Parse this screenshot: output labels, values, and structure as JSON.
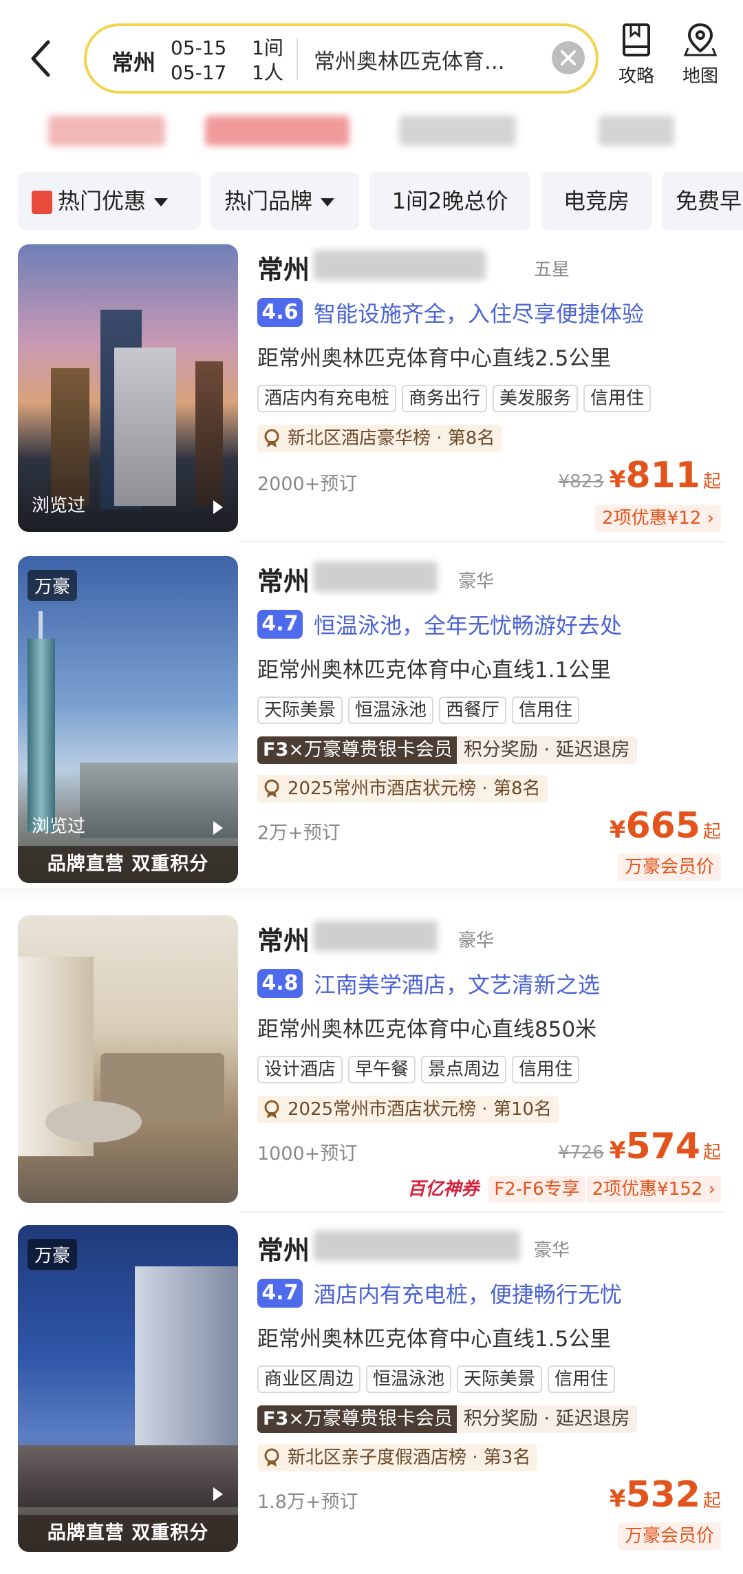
{
  "search": {
    "city": "常州",
    "checkin": "05-15",
    "checkout": "05-17",
    "rooms": "1间",
    "guests": "1人",
    "query": "常州奥林匹克体育..."
  },
  "top_actions": {
    "guide": "攻略",
    "map": "地图"
  },
  "filters": [
    {
      "label": "热门优惠"
    },
    {
      "label": "热门品牌"
    },
    {
      "label": "1间2晚总价"
    },
    {
      "label": "电竞房"
    },
    {
      "label": "免费早"
    }
  ],
  "hotels": [
    {
      "name_prefix": "常州",
      "star": "五星",
      "score": "4.6",
      "slogan": "智能设施齐全，入住尽享便捷体验",
      "distance": "距常州奥林匹克体育中心直线2.5公里",
      "tags": [
        "酒店内有充电桩",
        "商务出行",
        "美发服务",
        "信用住"
      ],
      "rank": "新北区酒店豪华榜 · 第8名",
      "booked": "2000+预订",
      "orig_price": "¥823",
      "price": "811",
      "suffix": "起",
      "promo": "2项优惠¥12 ›",
      "viewed": "浏览过"
    },
    {
      "name_prefix": "常州",
      "star": "豪华",
      "score": "4.7",
      "slogan": "恒温泳池，全年无忧畅游好去处",
      "distance": "距常州奥林匹克体育中心直线1.1公里",
      "tags": [
        "天际美景",
        "恒温泳池",
        "西餐厅",
        "信用住"
      ],
      "member_f3": "F3",
      "member_x": "×万豪尊贵银卡会员",
      "member_benefit": "积分奖励 · 延迟退房",
      "rank": "2025常州市酒店状元榜 · 第8名",
      "booked": "2万+预订",
      "price": "665",
      "suffix": "起",
      "promo": "万豪会员价",
      "brand_badge": "万豪",
      "viewed": "浏览过",
      "brand_bar": "品牌直营 双重积分"
    },
    {
      "name_prefix": "常州",
      "star": "豪华",
      "score": "4.8",
      "slogan": "江南美学酒店，文艺清新之选",
      "distance": "距常州奥林匹克体育中心直线850米",
      "tags": [
        "设计酒店",
        "早午餐",
        "景点周边",
        "信用住"
      ],
      "rank": "2025常州市酒店状元榜 · 第10名",
      "booked": "1000+预订",
      "orig_price": "¥726",
      "price": "574",
      "suffix": "起",
      "promo_brand": "百亿神券",
      "promo_exclusive": "F2-F6专享",
      "promo": "2项优惠¥152 ›"
    },
    {
      "name_prefix": "常州",
      "star": "豪华",
      "score": "4.7",
      "slogan": "酒店内有充电桩，便捷畅行无忧",
      "distance": "距常州奥林匹克体育中心直线1.5公里",
      "tags": [
        "商业区周边",
        "恒温泳池",
        "天际美景",
        "信用住"
      ],
      "member_f3": "F3",
      "member_x": "×万豪尊贵银卡会员",
      "member_benefit": "积分奖励 · 延迟退房",
      "rank": "新北区亲子度假酒店榜 · 第3名",
      "booked": "1.8万+预订",
      "price": "532",
      "suffix": "起",
      "promo": "万豪会员价",
      "brand_badge": "万豪",
      "brand_bar": "品牌直营 双重积分"
    }
  ],
  "colors": {
    "accent": "#4f6bed",
    "price": "#e3541c",
    "search_border": "#f2d34e"
  }
}
